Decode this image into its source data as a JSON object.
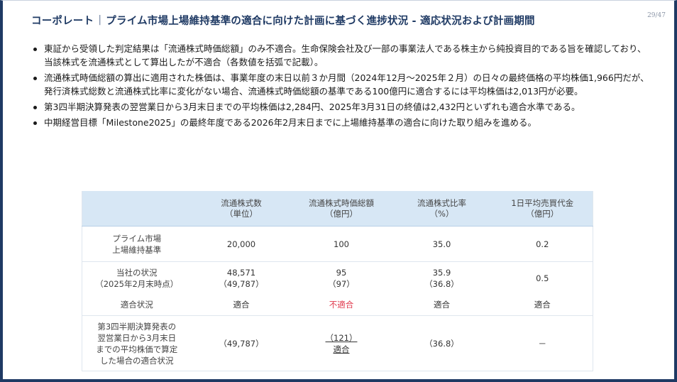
{
  "header": {
    "section": "コーポレート",
    "separator": "|",
    "title": "プライム市場上場維持基準の適合に向けた計画に基づく進捗状況 - 適応状況および計画期間",
    "page_number": "29/47"
  },
  "bullets": [
    "東証から受領した判定結果は「流通株式時価総額」のみ不適合。生命保険会社及び一部の事業法人である株主から純投資目的である旨を確認しており、当該株式を流通株式として算出したが不適合（各数値を括弧で記載）。",
    "流通株式時価総額の算出に適用された株価は、事業年度の末日以前３か月間（2024年12月～2025年２月）の日々の最終価格の平均株価1,966円だが、発行済株式総数と流通株式比率に変化がない場合、流通株式時価総額の基準である100億円に適合するには平均株価は2,013円が必要。",
    "第3四半期決算発表の翌営業日から3月末日までの平均株価は2,284円、2025年3月31日の終値は2,432円といずれも適合水準である。",
    "中期経営目標「Milestone2025」の最終年度である2026年2月末日までに上場維持基準の適合に向けた取り組みを進める。"
  ],
  "table": {
    "headers": [
      {
        "l1": "",
        "l2": ""
      },
      {
        "l1": "流通株式数",
        "l2": "（単位）"
      },
      {
        "l1": "流通株式時価総額",
        "l2": "（億円）"
      },
      {
        "l1": "流通株式比率",
        "l2": "（%）"
      },
      {
        "l1": "1日平均売買代金",
        "l2": "（億円）"
      }
    ],
    "rows": {
      "prime": {
        "label_l1": "プライム市場",
        "label_l2": "上場維持基準",
        "cells": [
          "20,000",
          "100",
          "35.0",
          "0.2"
        ]
      },
      "company": {
        "label_l1": "当社の状況",
        "label_l2": "（2025年2月末時点）",
        "c1_l1": "48,571",
        "c1_l2": "（49,787）",
        "c2_l1": "95",
        "c2_l2": "（97）",
        "c3_l1": "35.9",
        "c3_l2": "（36.8）",
        "c4": "0.5"
      },
      "compliance": {
        "label": "適合状況",
        "cells": [
          "適合",
          "不適合",
          "適合",
          "適合"
        ]
      },
      "q3": {
        "label_l1": "第3四半期決算発表の",
        "label_l2": "翌営業日から3月末日",
        "label_l3": "までの平均株価で算定",
        "label_l4": "した場合の適合状況",
        "c1": "（49,787）",
        "c2_l1": "（121）",
        "c2_l2": "適合",
        "c3": "（36.8）",
        "c4": "－"
      }
    }
  },
  "colors": {
    "title": "#1f3a64",
    "table_header_bg": "#d7e7f5",
    "noncompliant": "#e0394c"
  }
}
